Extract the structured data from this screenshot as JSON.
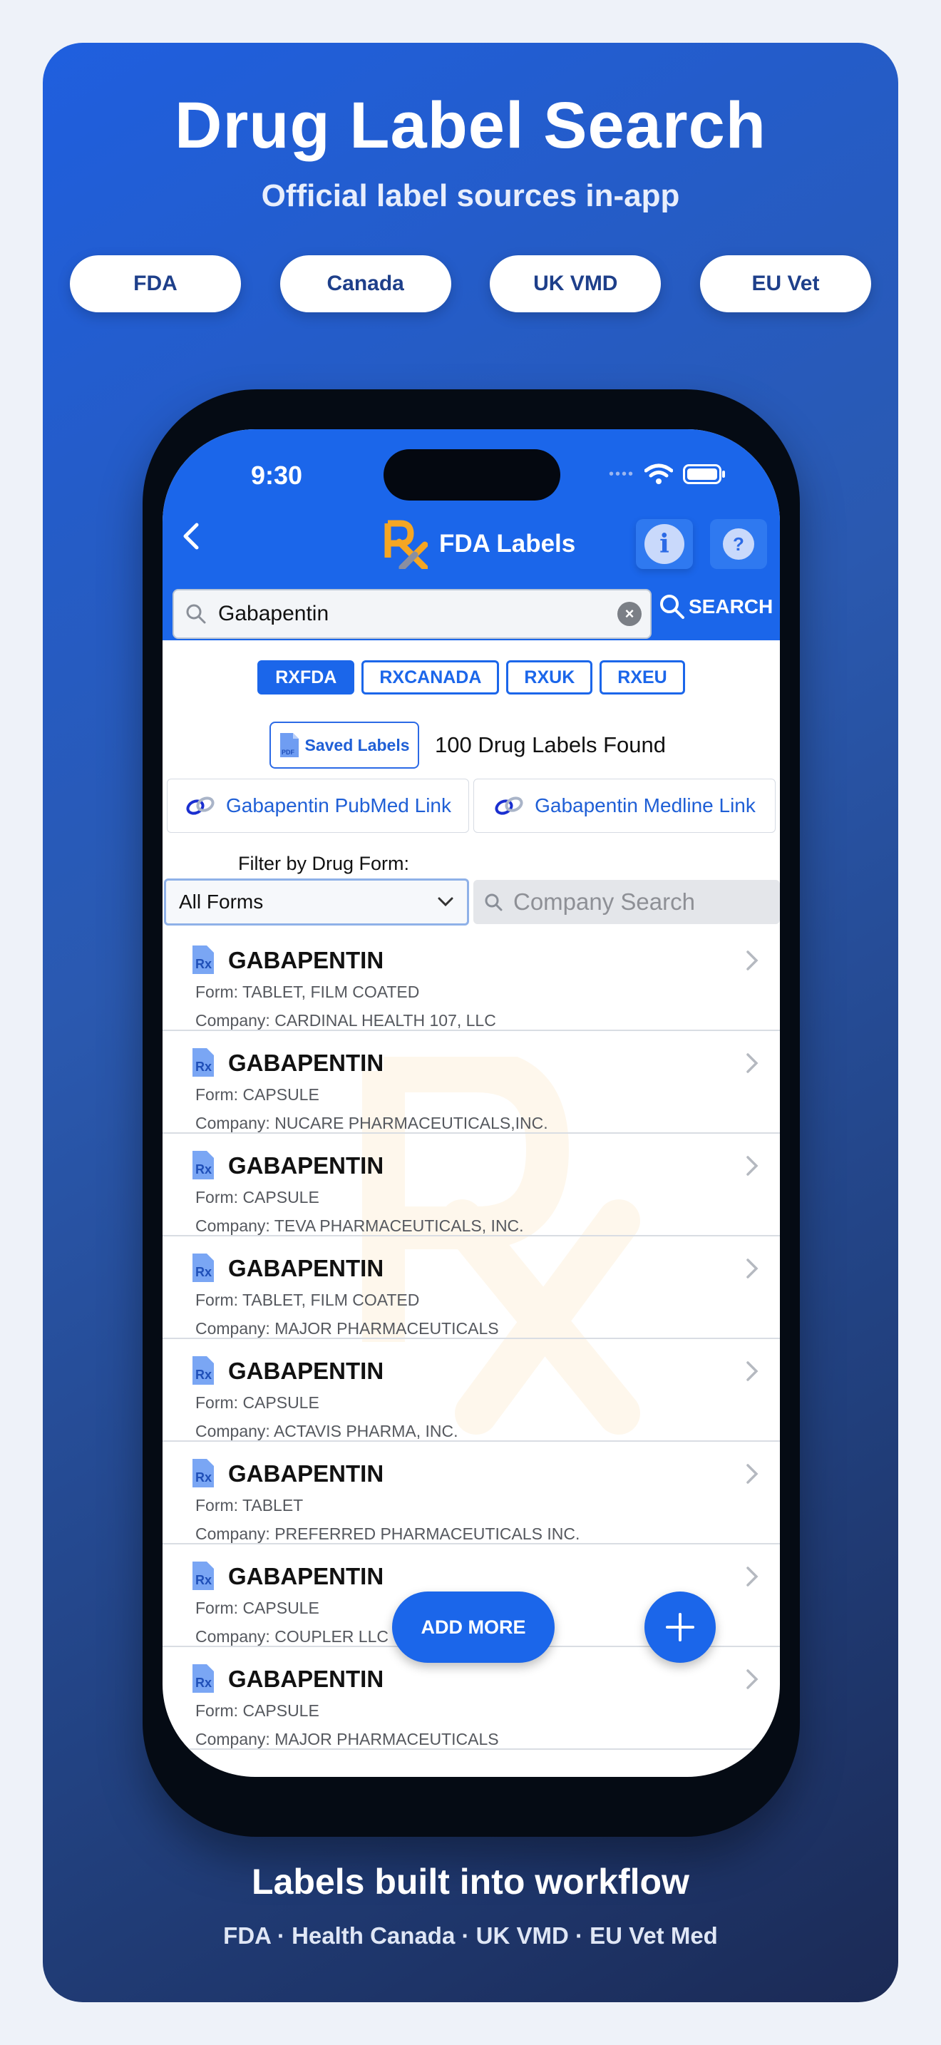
{
  "hero": {
    "title": "Drug Label Search",
    "subtitle": "Official label sources in-app",
    "pills": [
      "FDA",
      "Canada",
      "UK VMD",
      "EU Vet"
    ]
  },
  "status_bar": {
    "time": "9:30"
  },
  "nav": {
    "title": "FDA Labels",
    "info_icon": "i",
    "help_icon": "?"
  },
  "search": {
    "value": "Gabapentin",
    "button_label": "SEARCH"
  },
  "sources": [
    "RXFDA",
    "RXCANADA",
    "RXUK",
    "RXEU"
  ],
  "saved": {
    "label": "Saved Labels",
    "found_text": "100 Drug Labels Found"
  },
  "links": {
    "pubmed": "Gabapentin PubMed Link",
    "medline": "Gabapentin Medline Link"
  },
  "filter": {
    "label": "Filter by Drug Form:",
    "selected": "All Forms",
    "company_placeholder": "Company Search"
  },
  "results": [
    {
      "name": "GABAPENTIN",
      "form": "Form: TABLET, FILM COATED",
      "company": "Company: CARDINAL HEALTH 107, LLC"
    },
    {
      "name": "GABAPENTIN",
      "form": "Form: CAPSULE",
      "company": "Company: NUCARE PHARMACEUTICALS,INC."
    },
    {
      "name": "GABAPENTIN",
      "form": "Form: CAPSULE",
      "company": "Company: TEVA PHARMACEUTICALS, INC."
    },
    {
      "name": "GABAPENTIN",
      "form": "Form: TABLET, FILM COATED",
      "company": "Company: MAJOR PHARMACEUTICALS"
    },
    {
      "name": "GABAPENTIN",
      "form": "Form: CAPSULE",
      "company": "Company: ACTAVIS PHARMA, INC."
    },
    {
      "name": "GABAPENTIN",
      "form": "Form: TABLET",
      "company": "Company: PREFERRED PHARMACEUTICALS INC."
    },
    {
      "name": "GABAPENTIN",
      "form": "Form: CAPSULE",
      "company": "Company: COUPLER LLC"
    },
    {
      "name": "GABAPENTIN",
      "form": "Form: CAPSULE",
      "company": "Company: MAJOR PHARMACEUTICALS"
    }
  ],
  "actions": {
    "add_more": "ADD MORE"
  },
  "footer": {
    "title": "Labels built into workflow",
    "subtitle": "FDA · Health Canada · UK VMD · EU Vet Med"
  },
  "colors": {
    "brand_blue": "#1b66ea",
    "rx_orange": "#f5a623"
  }
}
